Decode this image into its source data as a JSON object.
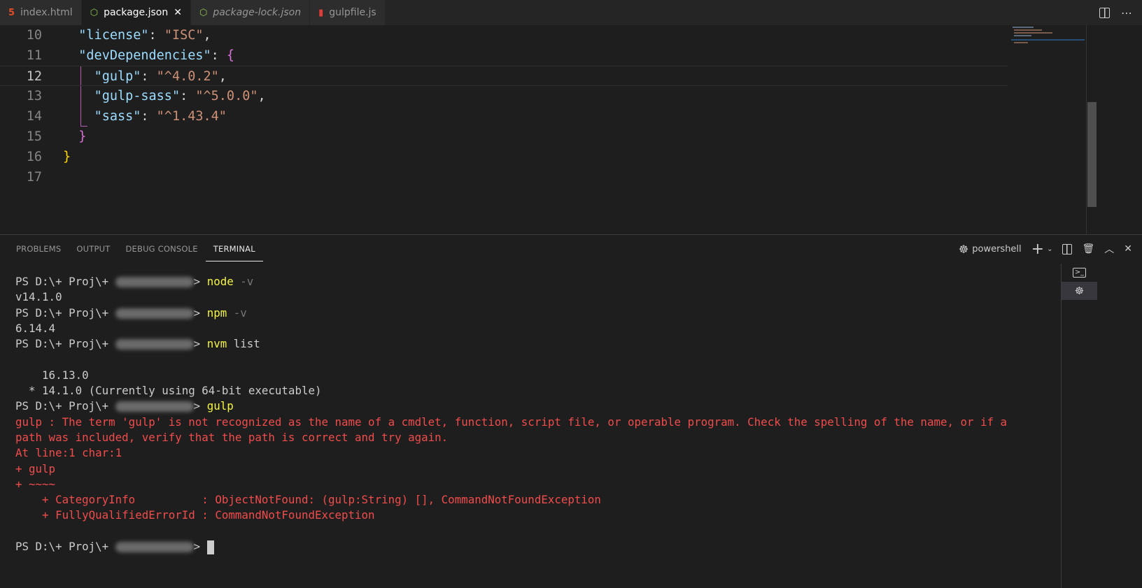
{
  "tabs": [
    {
      "label": "index.html",
      "icon": "html5-icon",
      "icon_glyph": "5",
      "icon_color": "#e44d26",
      "active": false,
      "italic": false
    },
    {
      "label": "package.json",
      "icon": "nodejs-icon",
      "icon_glyph": "⬡",
      "icon_color": "#8cc84b",
      "active": true,
      "italic": false,
      "close": "✕"
    },
    {
      "label": "package-lock.json",
      "icon": "nodejs-icon",
      "icon_glyph": "⬡",
      "icon_color": "#8cc84b",
      "active": false,
      "italic": true
    },
    {
      "label": "gulpfile.js",
      "icon": "gulp-icon",
      "icon_glyph": "▮",
      "icon_color": "#e03c3c",
      "active": false,
      "italic": false
    }
  ],
  "editor": {
    "current_line": 12,
    "line_numbers": [
      "10",
      "11",
      "12",
      "13",
      "14",
      "15",
      "16",
      "17"
    ],
    "lines": [
      {
        "indent": "  ",
        "key": "\"license\"",
        "colon": ": ",
        "value": "\"ISC\"",
        "tail": ","
      },
      {
        "indent": "  ",
        "key": "\"devDependencies\"",
        "colon": ": ",
        "brace": "{"
      },
      {
        "indent": "    ",
        "key": "\"gulp\"",
        "colon": ": ",
        "value": "\"^4.0.2\"",
        "tail": ","
      },
      {
        "indent": "    ",
        "key": "\"gulp-sass\"",
        "colon": ": ",
        "value": "\"^5.0.0\"",
        "tail": ","
      },
      {
        "indent": "    ",
        "key": "\"sass\"",
        "colon": ": ",
        "value": "\"^1.43.4\"",
        "tail": ""
      },
      {
        "indent": "  ",
        "brace": "}"
      },
      {
        "indent": "",
        "brace_outer": "}"
      },
      {
        "indent": ""
      }
    ]
  },
  "panel": {
    "tabs": [
      "PROBLEMS",
      "OUTPUT",
      "DEBUG CONSOLE",
      "TERMINAL"
    ],
    "active_tab": "TERMINAL",
    "shell_label": "powershell"
  },
  "terminal": {
    "prompt": "PS D:\\+ Proj\\+ ",
    "prompt_end": "> ",
    "lines": [
      {
        "type": "cmd",
        "cmd": "node",
        "args": " -v",
        "args_dim": true
      },
      {
        "type": "out",
        "text": "v14.1.0"
      },
      {
        "type": "cmd",
        "cmd": "npm",
        "args": " -v",
        "args_dim": true
      },
      {
        "type": "out",
        "text": "6.14.4"
      },
      {
        "type": "cmd",
        "cmd": "nvm",
        "args": " list",
        "args_dim": false
      },
      {
        "type": "out",
        "text": ""
      },
      {
        "type": "out",
        "text": "    16.13.0"
      },
      {
        "type": "out",
        "text": "  * 14.1.0 (Currently using 64-bit executable)"
      },
      {
        "type": "cmd",
        "cmd": "gulp",
        "args": "",
        "args_dim": false
      },
      {
        "type": "err",
        "text": "gulp : The term 'gulp' is not recognized as the name of a cmdlet, function, script file, or operable program. Check the spelling of the name, or if a"
      },
      {
        "type": "err",
        "text": "path was included, verify that the path is correct and try again."
      },
      {
        "type": "err",
        "text": "At line:1 char:1"
      },
      {
        "type": "err",
        "text": "+ gulp"
      },
      {
        "type": "err",
        "text": "+ ~~~~"
      },
      {
        "type": "err",
        "text": "    + CategoryInfo          : ObjectNotFound: (gulp:String) [], CommandNotFoundException"
      },
      {
        "type": "err",
        "text": "    + FullyQualifiedErrorId : CommandNotFoundException"
      },
      {
        "type": "out",
        "text": ""
      },
      {
        "type": "prompt_cursor"
      }
    ]
  },
  "colors": {
    "error": "#f14c4c",
    "command": "#f5f543",
    "accent": "#007acc"
  }
}
